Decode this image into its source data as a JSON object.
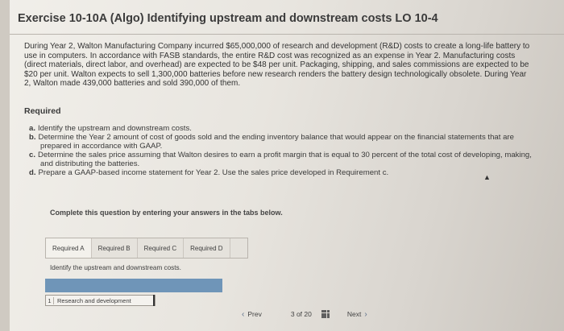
{
  "title": "Exercise 10-10A (Algo) Identifying upstream and downstream costs LO 10-4",
  "intro": "During Year 2, Walton Manufacturing Company incurred $65,000,000 of research and development (R&D) costs to create a long-life battery to use in computers. In accordance with FASB standards, the entire R&D cost was recognized as an expense in Year 2. Manufacturing costs (direct materials, direct labor, and overhead) are expected to be $48 per unit. Packaging, shipping, and sales commissions are expected to be $20 per unit. Walton expects to sell 1,300,000 batteries before new research renders the battery design technologically obsolete. During Year 2, Walton made 439,000 batteries and sold 390,000 of them.",
  "required_heading": "Required",
  "requirements": [
    {
      "letter": "a.",
      "text": "Identify the upstream and downstream costs."
    },
    {
      "letter": "b.",
      "text": "Determine the Year 2 amount of cost of goods sold and the ending inventory balance that would appear on the financial statements that are prepared in accordance with GAAP."
    },
    {
      "letter": "c.",
      "text": "Determine the sales price assuming that Walton desires to earn a profit margin that is equal to 30 percent of the total cost of developing, making, and distributing the batteries."
    },
    {
      "letter": "d.",
      "text": "Prepare a GAAP-based income statement for Year 2. Use the sales price developed in Requirement c."
    }
  ],
  "instruction": "Complete this question by entering your answers in the tabs below.",
  "tabs": [
    "Required A",
    "Required B",
    "Required C",
    "Required D"
  ],
  "tab_prompt": "Identify the upstream and downstream costs.",
  "table": {
    "row_number": "1",
    "row_label": "Research and development"
  },
  "nav": {
    "prev_label": "Prev",
    "page_current": "3",
    "page_of": "of",
    "page_total": "20",
    "next_label": "Next"
  },
  "colors": {
    "panel_header": "#6f95b8",
    "nav_chevron": "#5b6f8a"
  }
}
